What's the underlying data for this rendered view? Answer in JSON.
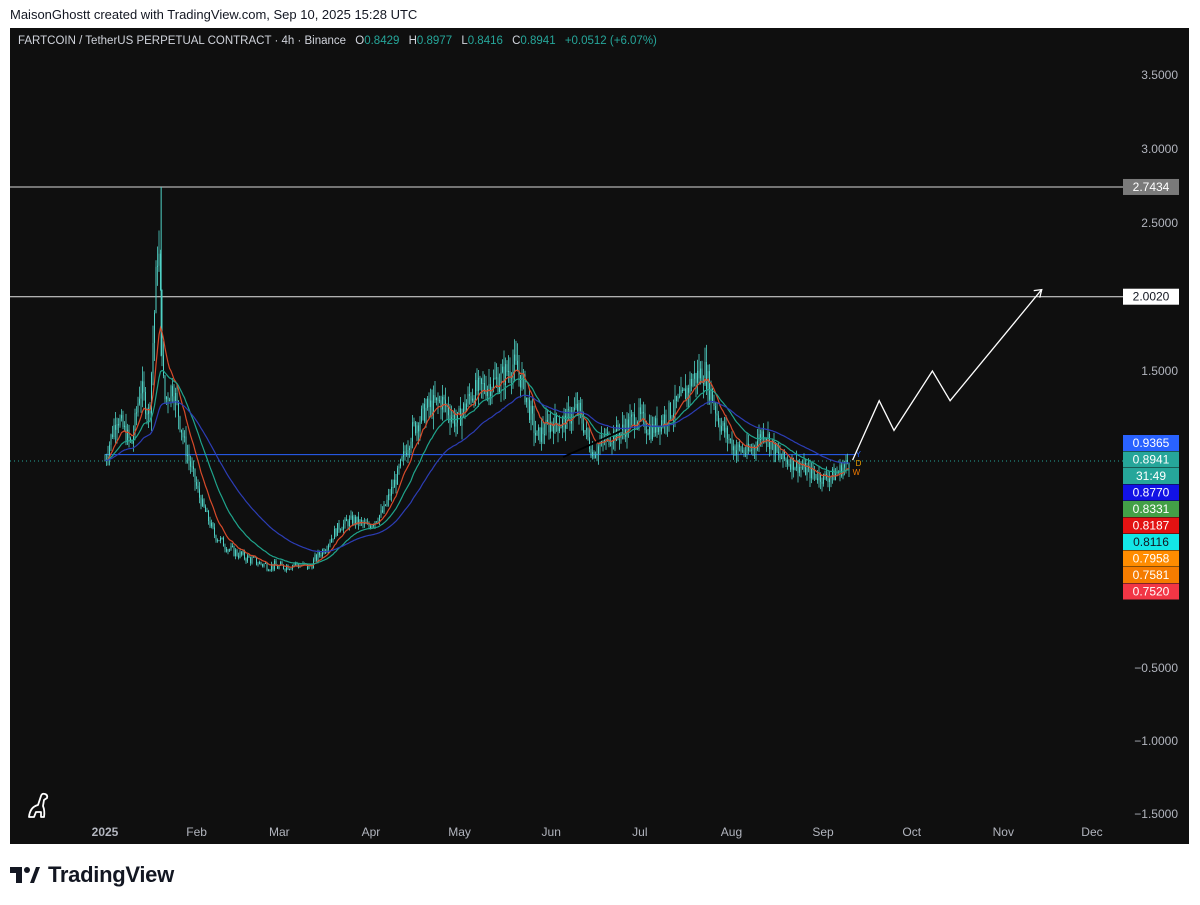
{
  "caption": "MaisonGhostt created with TradingView.com, Sep 10, 2025 15:28 UTC",
  "footer_brand": "TradingView",
  "colors": {
    "background": "#0f0f0f",
    "axis_text": "#b2b5be",
    "ohlc_value": "#26a69a",
    "candles": "#4fd1c5",
    "ema_red": "#d84a2a",
    "ema_teal": "#1fa48c",
    "ema_navy": "#2c3db5",
    "projection": "#ffffff",
    "current_price_line": "#26a69a"
  },
  "header": {
    "symbol": "FARTCOIN / TetherUS PERPETUAL CONTRACT · 4h · Binance",
    "open_label": "O",
    "open": "0.8429",
    "high_label": "H",
    "high": "0.8977",
    "low_label": "L",
    "low": "0.8416",
    "close_label": "C",
    "close": "0.8941",
    "change": "+0.0512 (+6.07%)"
  },
  "chart_data": {
    "type": "candlestick",
    "x_tick_labels": [
      "2025",
      "Feb",
      "Mar",
      "Apr",
      "May",
      "Jun",
      "Jul",
      "Aug",
      "Sep",
      "Oct",
      "Nov",
      "Dec"
    ],
    "y_tick_labels": [
      "3.5000",
      "3.0000",
      "2.5000",
      "1.5000",
      "−0.5000",
      "−1.0000",
      "−1.5000"
    ],
    "ylim": [
      -1.5,
      3.7
    ],
    "close_series": {
      "x": [
        "2025-01-01",
        "2025-01-05",
        "2025-01-10",
        "2025-01-13",
        "2025-01-16",
        "2025-01-19",
        "2025-01-21",
        "2025-01-24",
        "2025-01-28",
        "2025-02-02",
        "2025-02-07",
        "2025-02-12",
        "2025-02-17",
        "2025-02-23",
        "2025-03-01",
        "2025-03-06",
        "2025-03-11",
        "2025-03-16",
        "2025-03-21",
        "2025-03-26",
        "2025-03-31",
        "2025-04-05",
        "2025-04-10",
        "2025-04-15",
        "2025-04-20",
        "2025-04-25",
        "2025-04-30",
        "2025-05-05",
        "2025-05-10",
        "2025-05-15",
        "2025-05-19",
        "2025-05-22",
        "2025-05-27",
        "2025-06-01",
        "2025-06-05",
        "2025-06-10",
        "2025-06-15",
        "2025-06-20",
        "2025-06-25",
        "2025-06-30",
        "2025-07-05",
        "2025-07-10",
        "2025-07-15",
        "2025-07-19",
        "2025-07-23",
        "2025-07-28",
        "2025-08-02",
        "2025-08-07",
        "2025-08-12",
        "2025-08-17",
        "2025-08-22",
        "2025-08-27",
        "2025-09-01",
        "2025-09-05",
        "2025-09-10"
      ],
      "y": [
        0.9,
        1.2,
        1.0,
        1.4,
        1.2,
        2.4,
        1.3,
        1.4,
        1.0,
        0.65,
        0.4,
        0.3,
        0.25,
        0.2,
        0.18,
        0.2,
        0.18,
        0.3,
        0.45,
        0.5,
        0.45,
        0.55,
        0.8,
        1.1,
        1.25,
        1.3,
        1.15,
        1.35,
        1.4,
        1.45,
        1.55,
        1.45,
        1.05,
        1.15,
        1.15,
        1.25,
        0.95,
        1.05,
        1.1,
        1.2,
        1.1,
        1.2,
        1.3,
        1.45,
        1.5,
        1.15,
        0.98,
        0.95,
        1.1,
        0.92,
        0.88,
        0.82,
        0.78,
        0.8,
        0.8941
      ]
    },
    "ema_lines": [
      {
        "color": "#d84a2a"
      },
      {
        "color": "#1fa48c"
      },
      {
        "color": "#2c3db5"
      }
    ],
    "horizontal_levels": [
      {
        "price": "2.7434",
        "label_bg": "#7a7a7a",
        "label_fg": "#ffffff",
        "line": "#d9d9d9"
      },
      {
        "price": "2.0020",
        "label_bg": "#ffffff",
        "label_fg": "#131722",
        "line": "#e6e6e6"
      },
      {
        "price": "0.9365",
        "label_bg": "#2962ff",
        "label_fg": "#ffffff",
        "line": "#2962ff"
      }
    ],
    "price_labels": [
      {
        "text": "0.9365",
        "bg": "#2962ff",
        "fg": "#ffffff"
      },
      {
        "text": "0.8941",
        "bg": "#26a69a",
        "fg": "#ffffff"
      },
      {
        "text": "31:49",
        "bg": "#26a69a",
        "fg": "#ffffff"
      },
      {
        "text": "0.8770",
        "bg": "#1212e6",
        "fg": "#ffffff"
      },
      {
        "text": "0.8331",
        "bg": "#43a047",
        "fg": "#ffffff"
      },
      {
        "text": "0.8187",
        "bg": "#e31212",
        "fg": "#ffffff"
      },
      {
        "text": "0.8116",
        "bg": "#13e6e6",
        "fg": "#131722"
      },
      {
        "text": "0.7958",
        "bg": "#ff8c00",
        "fg": "#ffffff"
      },
      {
        "text": "0.7581",
        "bg": "#f57c00",
        "fg": "#ffffff"
      },
      {
        "text": "0.7520",
        "bg": "#f23645",
        "fg": "#ffffff"
      }
    ],
    "projection_path": {
      "x": [
        "2025-09-11",
        "2025-09-20",
        "2025-09-25",
        "2025-10-08",
        "2025-10-14",
        "2025-11-14"
      ],
      "y": [
        0.9,
        1.3,
        1.1,
        1.5,
        1.3,
        2.05
      ]
    },
    "grid": false,
    "tiny_markers": [
      "Y",
      "D",
      "W"
    ]
  }
}
